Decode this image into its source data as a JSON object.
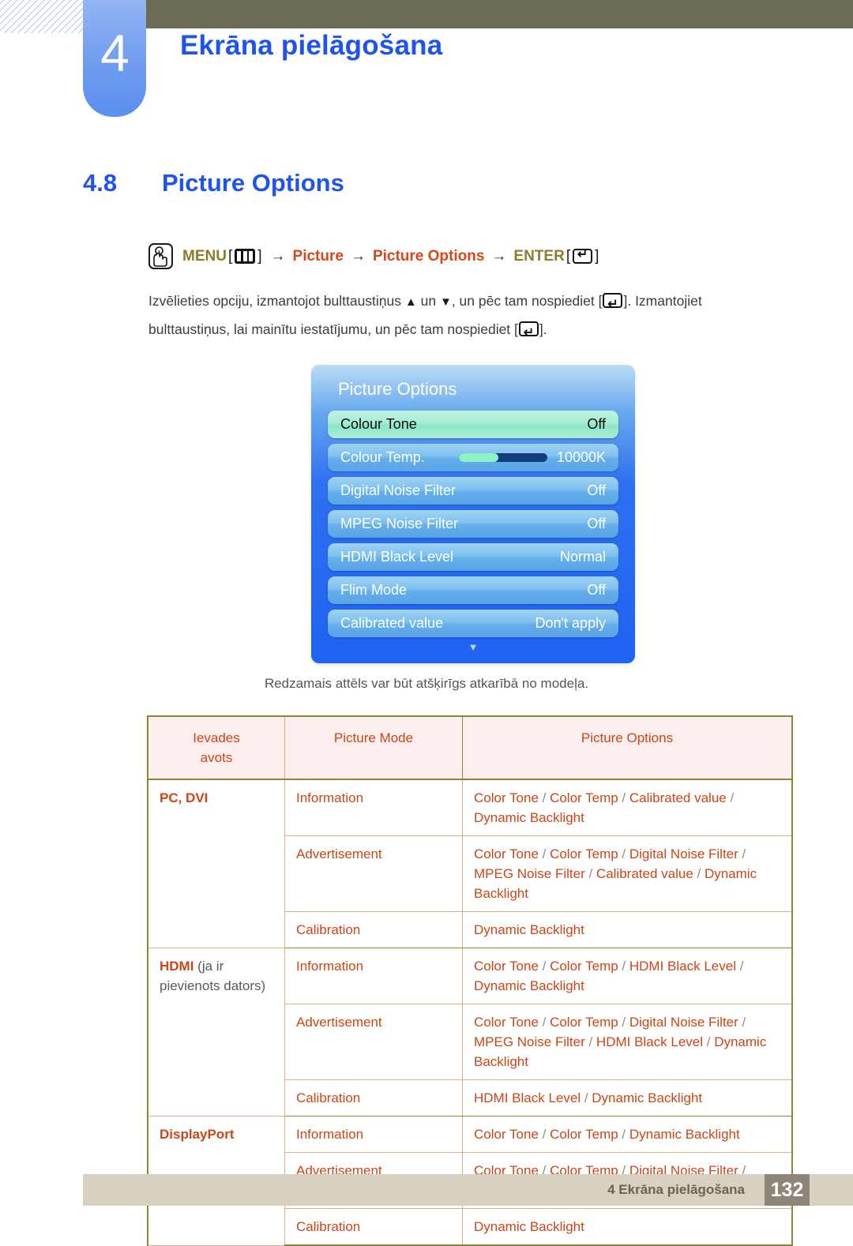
{
  "header": {
    "chapter_number": "4",
    "chapter_title": "Ekrāna pielāgošana"
  },
  "section": {
    "number": "4.8",
    "title": "Picture Options"
  },
  "menu_path": {
    "hand_icon": "hand-press-icon",
    "menu_label": "MENU",
    "menu_key_icon": "menu-key-icon",
    "arrow1": "→",
    "item1": "Picture",
    "arrow2": "→",
    "item2": "Picture Options",
    "arrow3": "→",
    "enter_label": "ENTER",
    "enter_key_icon": "enter-key-icon",
    "bracket_open": "[",
    "bracket_close": "]"
  },
  "instructions": {
    "line1_a": "Izvēlieties opciju, izmantojot bulttaustiņus ",
    "up_arrow": "▲",
    "line1_b": " un ",
    "down_arrow": "▼",
    "line1_c": ", un pēc tam nospiediet [",
    "line1_d": "]. Izmantojiet bulttaustiņus, lai mainītu iestatījumu, un pēc tam nospiediet [",
    "line1_e": "]."
  },
  "osd": {
    "title": "Picture Options",
    "rows": [
      {
        "label": "Colour Tone",
        "value": "Off",
        "selected": true,
        "slider": null
      },
      {
        "label": "Colour Temp.",
        "value": "10000K",
        "selected": false,
        "slider": 45
      },
      {
        "label": "Digital Noise Filter",
        "value": "Off",
        "selected": false,
        "slider": null
      },
      {
        "label": "MPEG Noise Filter",
        "value": "Off",
        "selected": false,
        "slider": null
      },
      {
        "label": "HDMI Black Level",
        "value": "Normal",
        "selected": false,
        "slider": null
      },
      {
        "label": "Flim Mode",
        "value": "Off",
        "selected": false,
        "slider": null
      },
      {
        "label": "Calibrated value",
        "value": "Don't apply",
        "selected": false,
        "slider": null
      }
    ],
    "scroll_down_icon": "▼"
  },
  "caption": "Redzamais attēls var būt atšķirīgs atkarībā no modeļa.",
  "table": {
    "headers": [
      "Ievades avots",
      "Picture Mode",
      "Picture Options"
    ],
    "header_col1_line1": "Ievades",
    "header_col1_line2": "avots",
    "groups": [
      {
        "source": "PC, DVI",
        "source_note": "",
        "rows": [
          {
            "mode": "Information",
            "options": "Color Tone / Color Temp / Calibrated value / Dynamic Backlight"
          },
          {
            "mode": "Advertisement",
            "options": "Color Tone / Color Temp / Digital Noise Filter / MPEG Noise Filter / Calibrated value / Dynamic Backlight"
          },
          {
            "mode": "Calibration",
            "options": "Dynamic Backlight"
          }
        ]
      },
      {
        "source": "HDMI",
        "source_note": " (ja ir pievienots dators)",
        "rows": [
          {
            "mode": "Information",
            "options": "Color Tone / Color Temp / HDMI Black Level / Dynamic Backlight"
          },
          {
            "mode": "Advertisement",
            "options": "Color Tone / Color Temp / Digital Noise Filter / MPEG Noise Filter / HDMI Black Level / Dynamic Backlight"
          },
          {
            "mode": "Calibration",
            "options": "HDMI Black Level / Dynamic Backlight"
          }
        ]
      },
      {
        "source": "DisplayPort",
        "source_note": "",
        "rows": [
          {
            "mode": "Information",
            "options": "Color Tone / Color Temp / Dynamic Backlight"
          },
          {
            "mode": "Advertisement",
            "options": "Color Tone / Color Temp / Digital Noise Filter / MPEG Noise Filter / Dynamic Backlight"
          },
          {
            "mode": "Calibration",
            "options": "Dynamic Backlight"
          }
        ]
      }
    ]
  },
  "footer": {
    "text": "4 Ekrāna pielāgošana",
    "page": "132"
  },
  "colors": {
    "accent_blue": "#1f53ed",
    "orange_red": "#cc4516",
    "olive": "#8b7b2a",
    "olive_bar": "#6e6b54",
    "footer_beige": "#d7d2bf",
    "page_box": "#8e8477"
  }
}
